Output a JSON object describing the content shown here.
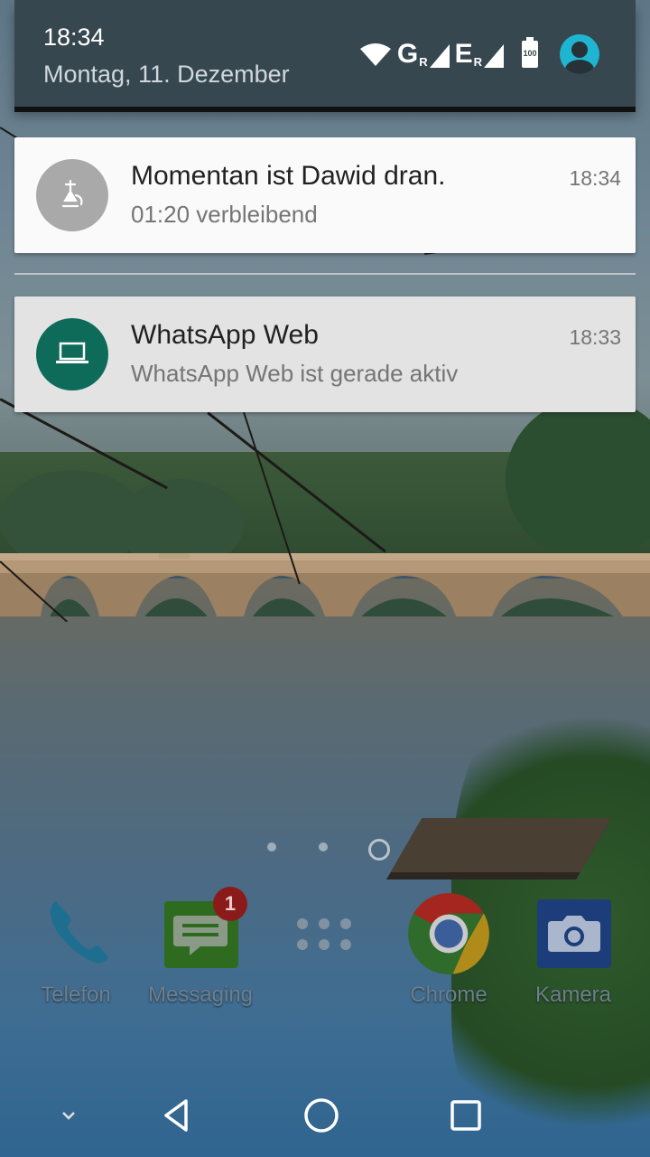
{
  "status": {
    "time": "18:34",
    "date": "Montag, 11. Dezember",
    "network_1": "G",
    "network_1_sup": "R",
    "network_2": "E",
    "network_2_sup": "R",
    "battery": "100"
  },
  "notifications": [
    {
      "title": "Momentan ist Dawid dran.",
      "text": "01:20 verbleibend",
      "time": "18:34",
      "icon": "hookah-icon"
    },
    {
      "title": "WhatsApp Web",
      "text": "WhatsApp Web ist gerade aktiv",
      "time": "18:33",
      "icon": "laptop-icon"
    }
  ],
  "dock": {
    "apps": [
      {
        "label": "Telefon",
        "icon": "phone-icon"
      },
      {
        "label": "Messaging",
        "icon": "message-icon",
        "badge": "1"
      },
      {
        "label": "",
        "icon": "app-drawer-icon"
      },
      {
        "label": "Chrome",
        "icon": "chrome-icon"
      },
      {
        "label": "Kamera",
        "icon": "camera-icon"
      }
    ]
  },
  "colors": {
    "shade": "#37474f",
    "whatsapp_green": "#0e6b5a",
    "avatar": "#1fb5d1",
    "badge": "#8b1a1a"
  }
}
